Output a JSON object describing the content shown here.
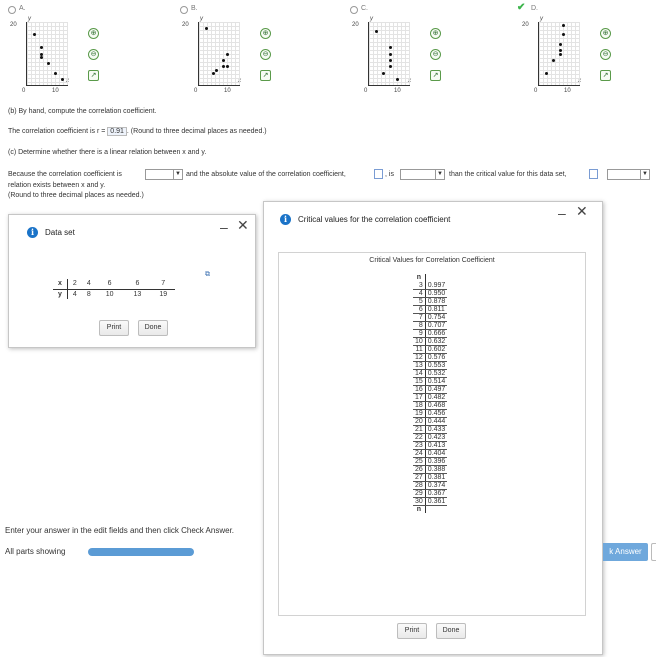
{
  "options": [
    {
      "letter": "A.",
      "selected": false,
      "y_tick": "20",
      "x_zero": "0",
      "x_tick": "10",
      "y_axis": "y",
      "x_axis": "x",
      "points": [
        [
          2,
          16
        ],
        [
          4,
          12
        ],
        [
          4,
          10
        ],
        [
          4,
          9
        ],
        [
          6,
          7
        ],
        [
          8,
          4
        ],
        [
          10,
          2
        ]
      ]
    },
    {
      "letter": "B.",
      "selected": false,
      "y_tick": "20",
      "x_zero": "0",
      "x_tick": "10",
      "y_axis": "y",
      "x_axis": "x",
      "points": [
        [
          2,
          18
        ],
        [
          7,
          8
        ],
        [
          7,
          6
        ],
        [
          5,
          5
        ],
        [
          8,
          6
        ],
        [
          8,
          10
        ],
        [
          4,
          4
        ]
      ]
    },
    {
      "letter": "C.",
      "selected": false,
      "y_tick": "20",
      "x_zero": "0",
      "x_tick": "10",
      "y_axis": "y",
      "x_axis": "x",
      "points": [
        [
          2,
          17
        ],
        [
          4,
          4
        ],
        [
          6,
          8
        ],
        [
          6,
          10
        ],
        [
          6,
          12
        ],
        [
          6,
          6
        ],
        [
          8,
          2
        ]
      ]
    },
    {
      "letter": "D.",
      "selected": true,
      "y_tick": "20",
      "x_zero": "0",
      "x_tick": "10",
      "y_axis": "y",
      "x_axis": "x",
      "points": [
        [
          2,
          4
        ],
        [
          4,
          8
        ],
        [
          6,
          10
        ],
        [
          6,
          13
        ],
        [
          7,
          19
        ],
        [
          6,
          11
        ],
        [
          7,
          16
        ]
      ]
    }
  ],
  "part_b": {
    "heading": "(b) By hand, compute the correlation coefficient.",
    "line_prefix": "The correlation coefficient is r =",
    "r_value": "0.91",
    "line_suffix": ". (Round to three decimal places as needed.)"
  },
  "part_c": {
    "heading": "(c) Determine whether there is a linear relation between x and y.",
    "s1": "Because the correlation coefficient is",
    "s2": "and the absolute value of the correlation coefficient,",
    "s3": ", is",
    "s4": "than the critical value for this data set,",
    "s5": "relation exists between x and y.",
    "s6": "(Round to three decimal places as needed.)"
  },
  "dataset_window": {
    "title": "Data set",
    "x_label": "x",
    "y_label": "y",
    "x_values": [
      "2",
      "4",
      "6",
      "6",
      "7"
    ],
    "y_values": [
      "4",
      "8",
      "10",
      "13",
      "19"
    ],
    "print": "Print",
    "done": "Done"
  },
  "critical_window": {
    "title": "Critical values for the correlation coefficient",
    "table_title": "Critical Values for Correlation Coefficient",
    "col_header": "n",
    "footer_n": "n",
    "rows": [
      [
        "3",
        "0.997"
      ],
      [
        "4",
        "0.950"
      ],
      [
        "5",
        "0.878"
      ],
      [
        "6",
        "0.811"
      ],
      [
        "7",
        "0.754"
      ],
      [
        "8",
        "0.707"
      ],
      [
        "9",
        "0.666"
      ],
      [
        "10",
        "0.632"
      ],
      [
        "11",
        "0.602"
      ],
      [
        "12",
        "0.576"
      ],
      [
        "13",
        "0.553"
      ],
      [
        "14",
        "0.532"
      ],
      [
        "15",
        "0.514"
      ],
      [
        "16",
        "0.497"
      ],
      [
        "17",
        "0.482"
      ],
      [
        "18",
        "0.468"
      ],
      [
        "19",
        "0.456"
      ],
      [
        "20",
        "0.444"
      ],
      [
        "21",
        "0.433"
      ],
      [
        "22",
        "0.423"
      ],
      [
        "23",
        "0.413"
      ],
      [
        "24",
        "0.404"
      ],
      [
        "25",
        "0.396"
      ],
      [
        "26",
        "0.388"
      ],
      [
        "27",
        "0.381"
      ],
      [
        "28",
        "0.374"
      ],
      [
        "29",
        "0.367"
      ],
      [
        "30",
        "0.361"
      ]
    ],
    "print": "Print",
    "done": "Done"
  },
  "footer": {
    "instruction": "Enter your answer in the edit fields and then click Check Answer.",
    "all_parts": "All parts showing",
    "check_answer": "k Answer"
  }
}
